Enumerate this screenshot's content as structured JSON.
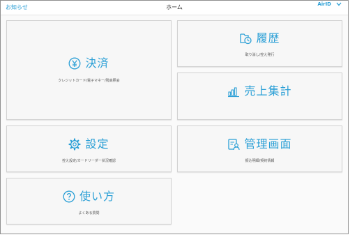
{
  "navbar": {
    "left_link": "お知らせ",
    "title": "ホーム",
    "account": "AirID",
    "account_icon": "chevron-down-icon"
  },
  "accent_color": "#2a9fd6",
  "tiles": {
    "payment": {
      "label": "決済",
      "sub": "クレジットカード/電子マネー/残高照会",
      "icon": "yen-icon"
    },
    "history": {
      "label": "履歴",
      "sub": "取り消し/控え発行",
      "icon": "history-icon"
    },
    "sales": {
      "label": "売上集計",
      "sub": "",
      "icon": "bar-chart-icon"
    },
    "settings": {
      "label": "設定",
      "sub": "控え設定/カードリーダー状況確認",
      "icon": "gear-icon"
    },
    "admin": {
      "label": "管理画面",
      "sub": "振込明細/契約情報",
      "icon": "admin-icon"
    },
    "help": {
      "label": "使い方",
      "sub": "よくある質問",
      "icon": "help-icon"
    }
  }
}
